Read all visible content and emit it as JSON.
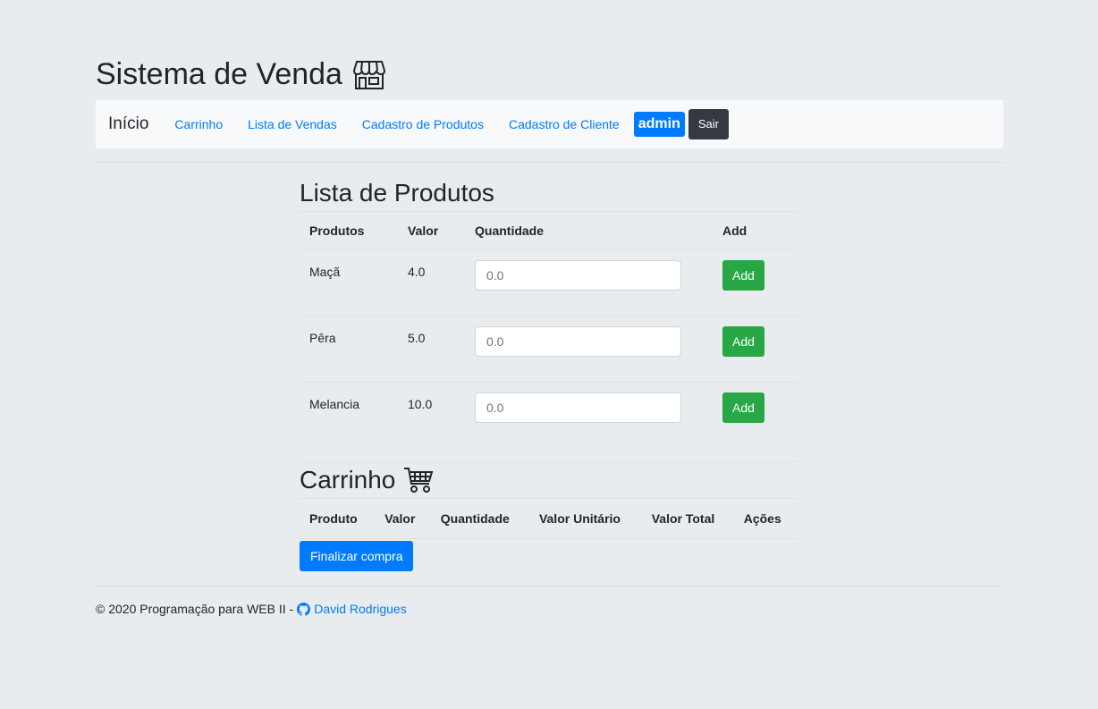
{
  "header": {
    "title": "Sistema de Venda",
    "icon": "store-icon"
  },
  "nav": {
    "brand": "Início",
    "links": [
      "Carrinho",
      "Lista de Vendas",
      "Cadastro de Produtos",
      "Cadastro de Cliente"
    ],
    "user_badge": "admin",
    "logout_label": "Sair"
  },
  "products": {
    "title": "Lista de Produtos",
    "columns": [
      "Produtos",
      "Valor",
      "Quantidade",
      "Add"
    ],
    "rows": [
      {
        "name": "Maçã",
        "value": "4.0",
        "qty_placeholder": "0.0",
        "add_label": "Add"
      },
      {
        "name": "Pêra",
        "value": "5.0",
        "qty_placeholder": "0.0",
        "add_label": "Add"
      },
      {
        "name": "Melancia",
        "value": "10.0",
        "qty_placeholder": "0.0",
        "add_label": "Add"
      }
    ]
  },
  "cart": {
    "title": "Carrinho",
    "icon": "shopping-cart-icon",
    "columns": [
      "Produto",
      "Valor",
      "Quantidade",
      "Valor Unitário",
      "Valor Total",
      "Ações"
    ],
    "finalize_label": "Finalizar compra"
  },
  "footer": {
    "text": "© 2020 Programação para WEB II -",
    "author": "David Rodrigues",
    "icon": "github-icon"
  },
  "colors": {
    "primary": "#007bff",
    "success": "#28a745",
    "dark": "#343a40",
    "background": "#e9ecef"
  }
}
